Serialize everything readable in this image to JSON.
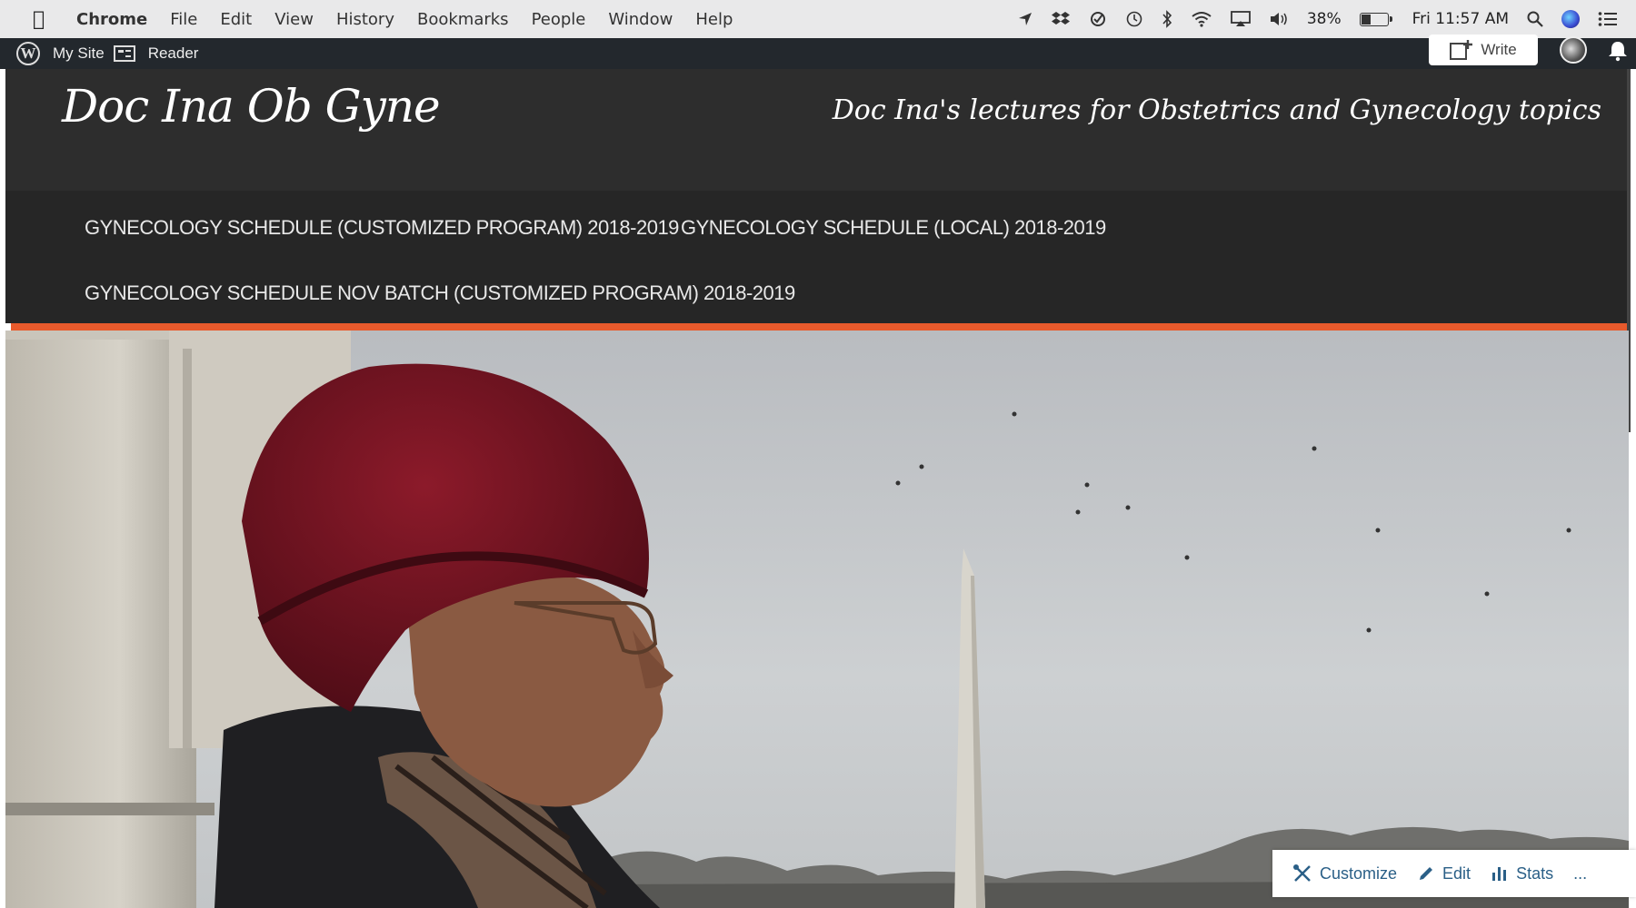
{
  "menubar": {
    "app": "Chrome",
    "items": [
      "File",
      "Edit",
      "View",
      "History",
      "Bookmarks",
      "People",
      "Window",
      "Help"
    ],
    "battery": "38%",
    "clock": "Fri 11:57 AM",
    "icons": [
      "location-arrow-icon",
      "dropbox-icon",
      "sync-icon",
      "time-machine-icon",
      "bluetooth-icon",
      "wifi-icon",
      "airplay-icon",
      "volume-icon",
      "battery-icon",
      "spotlight-search-icon",
      "siri-icon",
      "notification-center-icon"
    ]
  },
  "wpbar": {
    "my_site": "My Site",
    "reader": "Reader",
    "write": "Write"
  },
  "site": {
    "title": "Doc Ina Ob Gyne",
    "description": "Doc Ina's lectures for Obstetrics and Gynecology topics"
  },
  "nav": {
    "items": [
      "GYNECOLOGY SCHEDULE (CUSTOMIZED PROGRAM) 2018-2019",
      "GYNECOLOGY SCHEDULE (LOCAL) 2018-2019",
      "GYNECOLOGY SCHEDULE NOV BATCH (CUSTOMIZED PROGRAM) 2018-2019"
    ]
  },
  "toolbar": {
    "customize": "Customize",
    "edit": "Edit",
    "stats": "Stats",
    "more": "..."
  },
  "colors": {
    "accent": "#e85a2c",
    "header_bg": "#2d2d2d",
    "nav_bg": "#262626",
    "wpbar_bg": "#23282d",
    "toolbar_link": "#2a5f87"
  }
}
